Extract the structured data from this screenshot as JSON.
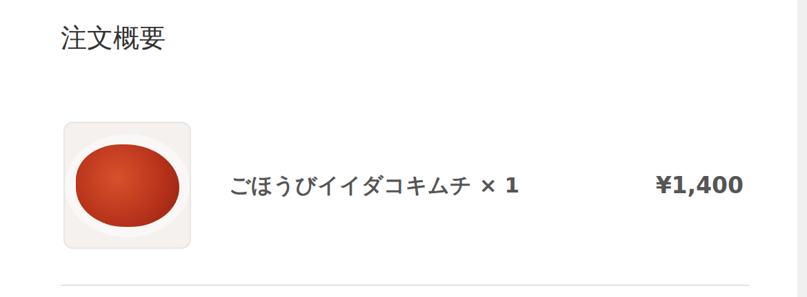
{
  "heading": "注文概要",
  "items": [
    {
      "name": "ごほうびイイダコキムチ × 1",
      "price": "¥1,400"
    }
  ]
}
